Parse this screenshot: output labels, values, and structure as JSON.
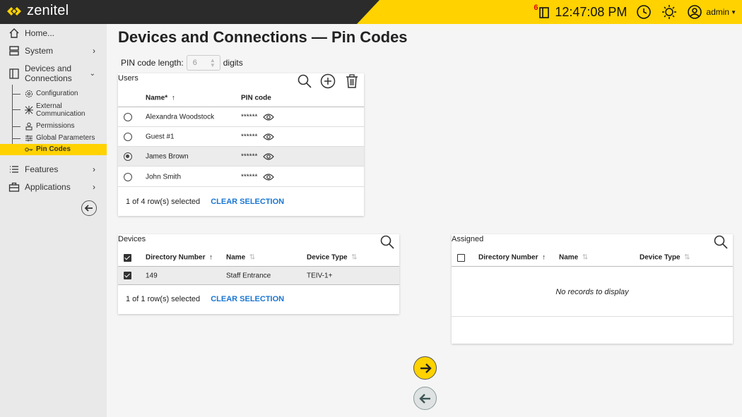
{
  "header": {
    "brand": "zenitel",
    "notification_count": "6",
    "time": "12:47:08 PM",
    "user": "admin",
    "colors": {
      "bar": "#2b2b2b",
      "accent": "#ffd200"
    }
  },
  "sidebar": {
    "home": "Home...",
    "system": "System",
    "devices": "Devices and Connections",
    "sub_items": {
      "configuration": "Configuration",
      "external": "External Communication",
      "permissions": "Permissions",
      "global": "Global Parameters",
      "pin_codes": "Pin Codes"
    },
    "features": "Features",
    "applications": "Applications"
  },
  "page": {
    "title": "Devices and Connections — Pin Codes",
    "pin_length_label": "PIN code length:",
    "pin_length_value": "6",
    "pin_length_unit": "digits"
  },
  "users": {
    "title": "Users",
    "col_name": "Name*",
    "col_pin": "PIN code",
    "rows": [
      {
        "name": "Alexandra Woodstock",
        "pin": "******",
        "selected": false
      },
      {
        "name": "Guest #1",
        "pin": "******",
        "selected": false
      },
      {
        "name": "James Brown",
        "pin": "******",
        "selected": true
      },
      {
        "name": "John Smith",
        "pin": "******",
        "selected": false
      }
    ],
    "footer": "1 of 4 row(s) selected",
    "clear": "CLEAR SELECTION"
  },
  "devices": {
    "title": "Devices",
    "col_dir": "Directory Number",
    "col_name": "Name",
    "col_type": "Device Type",
    "rows": [
      {
        "dir": "149",
        "name": "Staff Entrance",
        "type": "TEIV-1+",
        "checked": true
      }
    ],
    "footer": "1 of 1 row(s) selected",
    "clear": "CLEAR SELECTION"
  },
  "assigned": {
    "title": "Assigned",
    "col_dir": "Directory Number",
    "col_name": "Name",
    "col_type": "Device Type",
    "empty": "No records to display"
  }
}
